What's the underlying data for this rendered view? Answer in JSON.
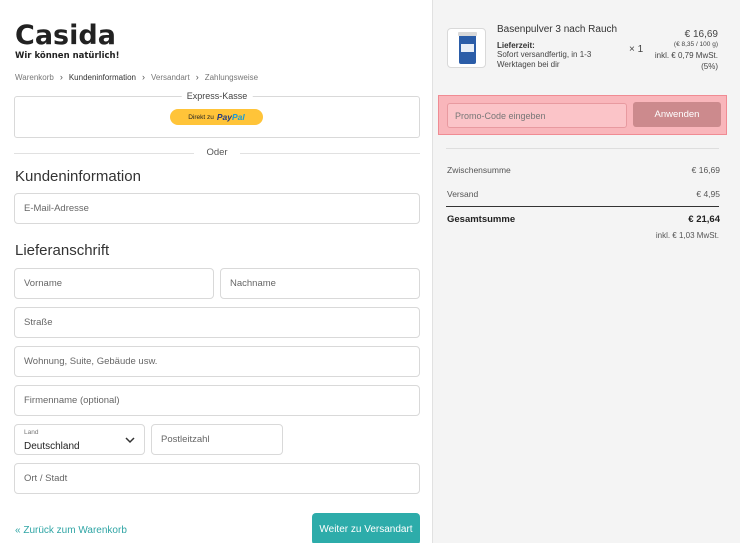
{
  "brand": {
    "name": "Casida",
    "tagline": "Wir können natürlich!"
  },
  "breadcrumb": [
    "Warenkorb",
    "Kundeninformation",
    "Versandart",
    "Zahlungsweise"
  ],
  "express": {
    "label": "Express-Kasse",
    "paypal_prefix": "Direkt zu",
    "paypal_pay": "Pay",
    "paypal_pal": "Pal"
  },
  "divider_text": "Oder",
  "customer_info": {
    "title": "Kundeninformation",
    "email_placeholder": "E-Mail-Adresse"
  },
  "shipping": {
    "title": "Lieferanschrift",
    "first_name_placeholder": "Vorname",
    "last_name_placeholder": "Nachname",
    "street_placeholder": "Straße",
    "apartment_placeholder": "Wohnung, Suite, Gebäude usw.",
    "company_placeholder": "Firmenname (optional)",
    "country_label": "Land",
    "country_value": "Deutschland",
    "zip_placeholder": "Postleitzahl",
    "city_placeholder": "Ort / Stadt"
  },
  "footer": {
    "back_label": "« Zurück zum Warenkorb",
    "next_label": "Weiter zu Versandart"
  },
  "product": {
    "name": "Basenpulver 3 nach Rauch",
    "delivery_label": "Lieferzeit:",
    "delivery_text": "Sofort versandfertig, in 1-3 Werktagen bei dir",
    "quantity": "× 1",
    "price": "€ 16,69",
    "unit_price": "(€ 8,35 / 100 g)",
    "vat": "inkl. € 0,79 MwSt. (5%)"
  },
  "promo": {
    "placeholder": "Promo-Code eingeben",
    "button": "Anwenden"
  },
  "summary": {
    "subtotal_label": "Zwischensumme",
    "subtotal_value": "€ 16,69",
    "shipping_label": "Versand",
    "shipping_value": "€ 4,95",
    "total_label": "Gesamtsumme",
    "total_value": "€ 21,64",
    "total_vat": "inkl. € 1,03 MwSt."
  },
  "colors": {
    "accent": "#2dacaa",
    "promo_highlight": "#f9b6bb",
    "paypal": "#ffc439"
  }
}
